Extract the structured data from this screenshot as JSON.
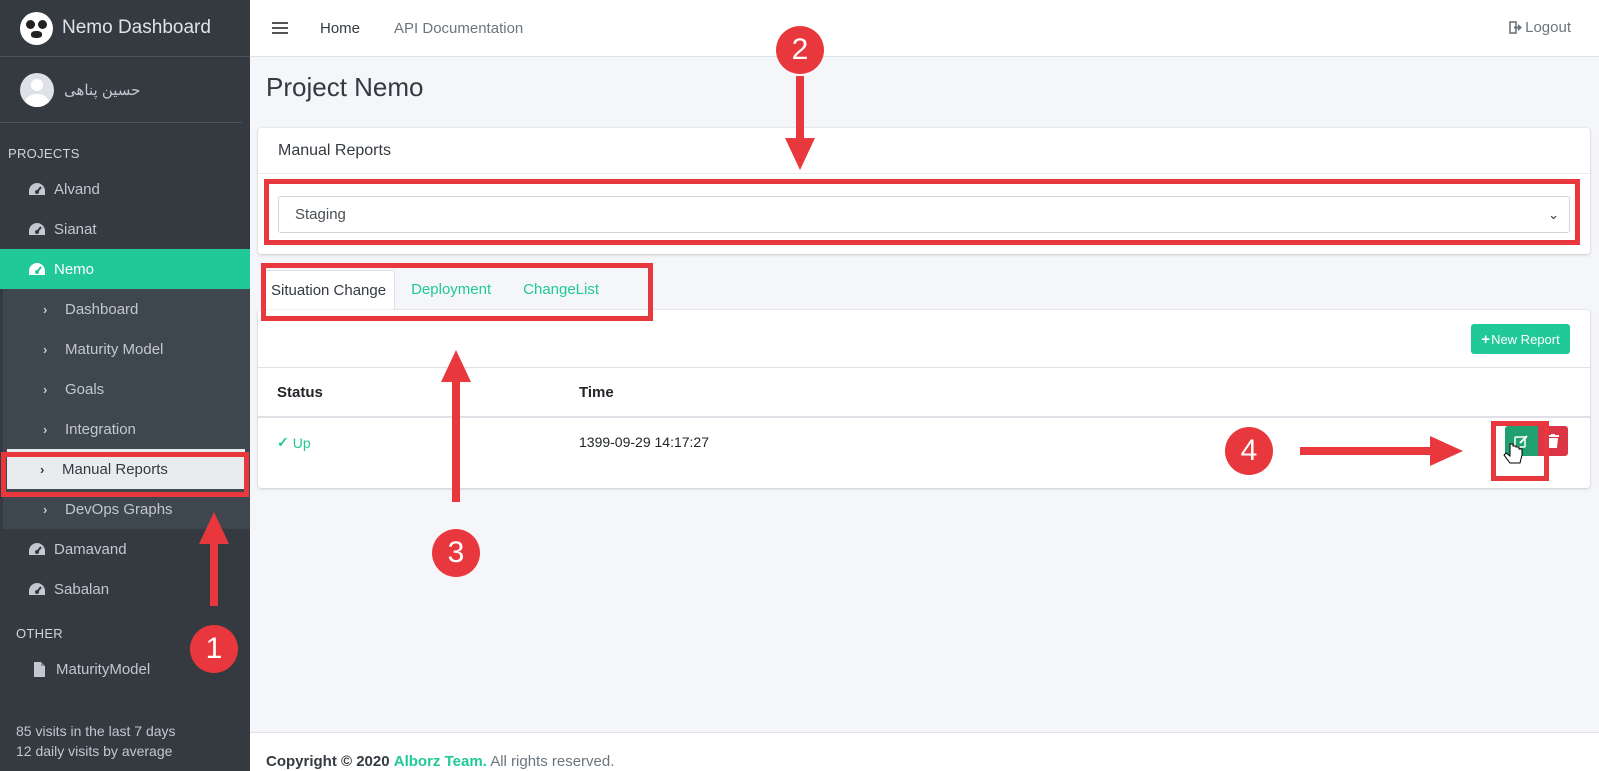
{
  "brand": {
    "title": "Nemo Dashboard"
  },
  "user": {
    "name": "حسین پناهی"
  },
  "sidebar": {
    "projects_header": "PROJECTS",
    "projects": [
      {
        "label": "Alvand"
      },
      {
        "label": "Sianat"
      },
      {
        "label": "Nemo"
      }
    ],
    "nemo_sub": [
      {
        "label": "Dashboard"
      },
      {
        "label": "Maturity Model"
      },
      {
        "label": "Goals"
      },
      {
        "label": "Integration"
      },
      {
        "label": "Manual Reports"
      },
      {
        "label": "DevOps Graphs"
      }
    ],
    "more_projects": [
      {
        "label": "Damavand"
      },
      {
        "label": "Sabalan"
      }
    ],
    "other_header": "OTHER",
    "other": [
      {
        "label": "MaturityModel"
      }
    ],
    "visits_line1": "85 visits in the last 7 days",
    "visits_line2": "12 daily visits by average"
  },
  "topbar": {
    "home": "Home",
    "api_docs": "API Documentation",
    "logout": "Logout"
  },
  "page": {
    "title": "Project Nemo",
    "card_header": "Manual Reports",
    "environment_select": "Staging",
    "tabs": [
      {
        "label": "Situation Change"
      },
      {
        "label": "Deployment"
      },
      {
        "label": "ChangeList"
      }
    ],
    "new_report": "New Report",
    "table": {
      "headers": [
        "Status",
        "Time"
      ],
      "rows": [
        {
          "status": "Up",
          "time": "1399-09-29 14:17:27"
        }
      ]
    }
  },
  "footer": {
    "copyright": "Copyright © 2020",
    "team": "Alborz Team.",
    "rights": "All rights reserved."
  },
  "annotations": [
    "1",
    "2",
    "3",
    "4"
  ],
  "colors": {
    "accent": "#20c997",
    "annotation": "#e8383d",
    "danger": "#dc3545",
    "sidebar": "#343a40"
  }
}
